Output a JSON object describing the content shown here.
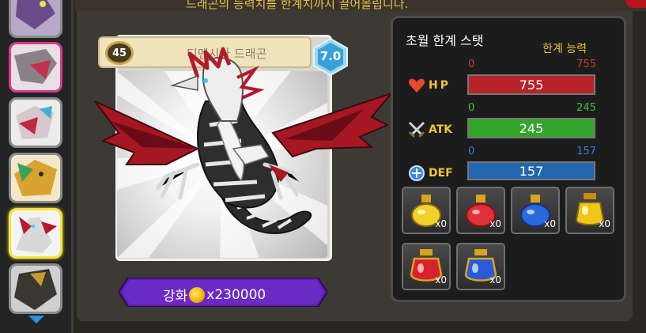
{
  "banner": {
    "text": "드래곤의 능력치를 한계치까지 끌어올립니다."
  },
  "sidebar": {
    "portraits": [
      {
        "name": "purple-dragon",
        "selected": false
      },
      {
        "name": "grey-pink-dragon",
        "selected": false
      },
      {
        "name": "white-red-dragon-small",
        "selected": false
      },
      {
        "name": "green-gold-dragon",
        "selected": false
      },
      {
        "name": "white-red-dragon",
        "selected": true
      },
      {
        "name": "dark-gold-dragon",
        "selected": false
      }
    ]
  },
  "card": {
    "level": "45",
    "name": "디멘시아 드래곤",
    "grade": "7.0"
  },
  "enhance": {
    "label": "강화",
    "cost": "x230000"
  },
  "stats": {
    "title": "초월 한계 스탯",
    "limit_label": "한계 능력",
    "items": [
      {
        "name": "HP",
        "min": "0",
        "max": "755",
        "value": "755",
        "fraction": 1.0,
        "color": "#b8232a",
        "label_color": "#f2c530"
      },
      {
        "name": "ATK",
        "min": "0",
        "max": "245",
        "value": "245",
        "fraction": 1.0,
        "color": "#34a52b",
        "label_color": "#f2c530"
      },
      {
        "name": "DEF",
        "min": "0",
        "max": "157",
        "value": "157",
        "fraction": 1.0,
        "color": "#2266b0",
        "label_color": "#f2c530"
      }
    ]
  },
  "potions": [
    {
      "name": "gold-potion-small",
      "count": "x0"
    },
    {
      "name": "red-potion-small",
      "count": "x0"
    },
    {
      "name": "blue-potion-small",
      "count": "x0"
    },
    {
      "name": "gold-potion-large",
      "count": "x0"
    },
    {
      "name": "red-potion-large",
      "count": "x0"
    },
    {
      "name": "blue-potion-large",
      "count": "x0"
    }
  ]
}
